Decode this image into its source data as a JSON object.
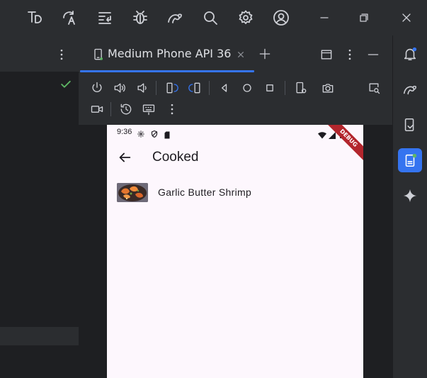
{
  "emulator": {
    "tab_label": "Medium Phone API 36"
  },
  "phone": {
    "status_time": "9:36",
    "debug_banner": "DEBUG",
    "app_title": "Cooked",
    "items": [
      {
        "title": "Garlic Butter Shrimp"
      }
    ]
  },
  "colors": {
    "accent": "#3574f0",
    "check": "#5fb865",
    "phone_bg": "#fdf7fd",
    "debug_ribbon": "#b3262d"
  }
}
